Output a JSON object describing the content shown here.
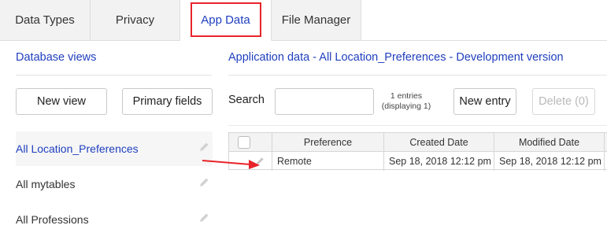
{
  "tabs": [
    {
      "label": "Data Types",
      "active": false
    },
    {
      "label": "Privacy",
      "active": false
    },
    {
      "label": "App Data",
      "active": true
    },
    {
      "label": "File Manager",
      "active": false
    }
  ],
  "left": {
    "title": "Database views",
    "new_view_label": "New view",
    "primary_fields_label": "Primary fields",
    "views": [
      {
        "label": "All Location_Preferences",
        "selected": true
      },
      {
        "label": "All mytables",
        "selected": false
      },
      {
        "label": "All Professions",
        "selected": false
      }
    ]
  },
  "right": {
    "title": "Application data - All Location_Preferences - Development version",
    "search_label": "Search",
    "search_value": "",
    "entries_count": "1 entries",
    "entries_display": "(displaying 1)",
    "new_entry_label": "New entry",
    "delete_label": "Delete (0)"
  },
  "table": {
    "columns": [
      "Preference",
      "Created Date",
      "Modified Date"
    ],
    "rows": [
      {
        "preference": "Remote",
        "created": "Sep 18, 2018 12:12 pm",
        "modified": "Sep 18, 2018 12:12 pm"
      }
    ]
  },
  "colors": {
    "accent": "#1f3fbf",
    "highlight": "#e8242a"
  },
  "icons": [
    "pencil-icon",
    "arrow-icon",
    "checkbox"
  ]
}
